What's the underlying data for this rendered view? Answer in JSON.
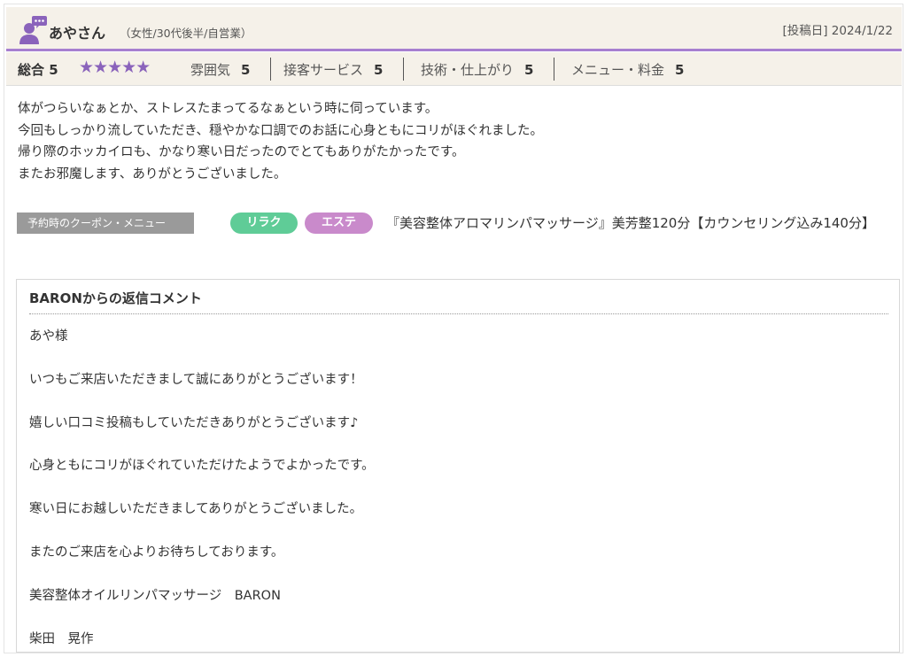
{
  "review": {
    "reviewer_name": "あやさん",
    "reviewer_profile": "（女性/30代後半/自営業）",
    "post_date": "[投稿日] 2024/1/22",
    "overall_label": "総合 5",
    "overall_rating": 5,
    "stars": "★★★★★",
    "categories": [
      {
        "label": "雰囲気",
        "value": "5"
      },
      {
        "label": "接客サービス",
        "value": "5"
      },
      {
        "label": "技術・仕上がり",
        "value": "5"
      },
      {
        "label": "メニュー・料金",
        "value": "5"
      }
    ],
    "body_lines": [
      "体がつらいなぁとか、ストレスたまってるなぁという時に伺っています。",
      "今回もしっかり流していただき、穏やかな口調でのお話に心身ともにコリがほぐれました。",
      "帰り際のホッカイロも、かなり寒い日だったのでとてもありがたかったです。",
      "またお邪魔します、ありがとうございました。"
    ],
    "coupon_label": "予約時のクーポン・メニュー",
    "tags": [
      "リラク",
      "エステ"
    ],
    "menu_text": "『美容整体アロマリンパマッサージ』美芳整120分【カウンセリング込み140分】"
  },
  "reply": {
    "title": "BARONからの返信コメント",
    "paragraphs": [
      "あや様",
      "いつもご来店いただきまして誠にありがとうございます！",
      "嬉しい口コミ投稿もしていただきありがとうございます♪",
      "心身ともにコリがほぐれていただけたようでよかったです。",
      "寒い日にお越しいただきましてありがとうございました。",
      "またのご来店を心よりお待ちしております。",
      "美容整体オイルリンパマッサージ　BARON",
      "柴田　晃作"
    ]
  },
  "icons": {
    "avatar": "person-icon",
    "speech": "speech-bubble-icon"
  },
  "colors": {
    "accent": "#a77fd0",
    "star": "#8a63bb",
    "header_bg": "#f5f1e9",
    "tag_relax": "#5fcc97",
    "tag_esthe": "#c98acb",
    "coupon_bg": "#9a9a9a"
  }
}
